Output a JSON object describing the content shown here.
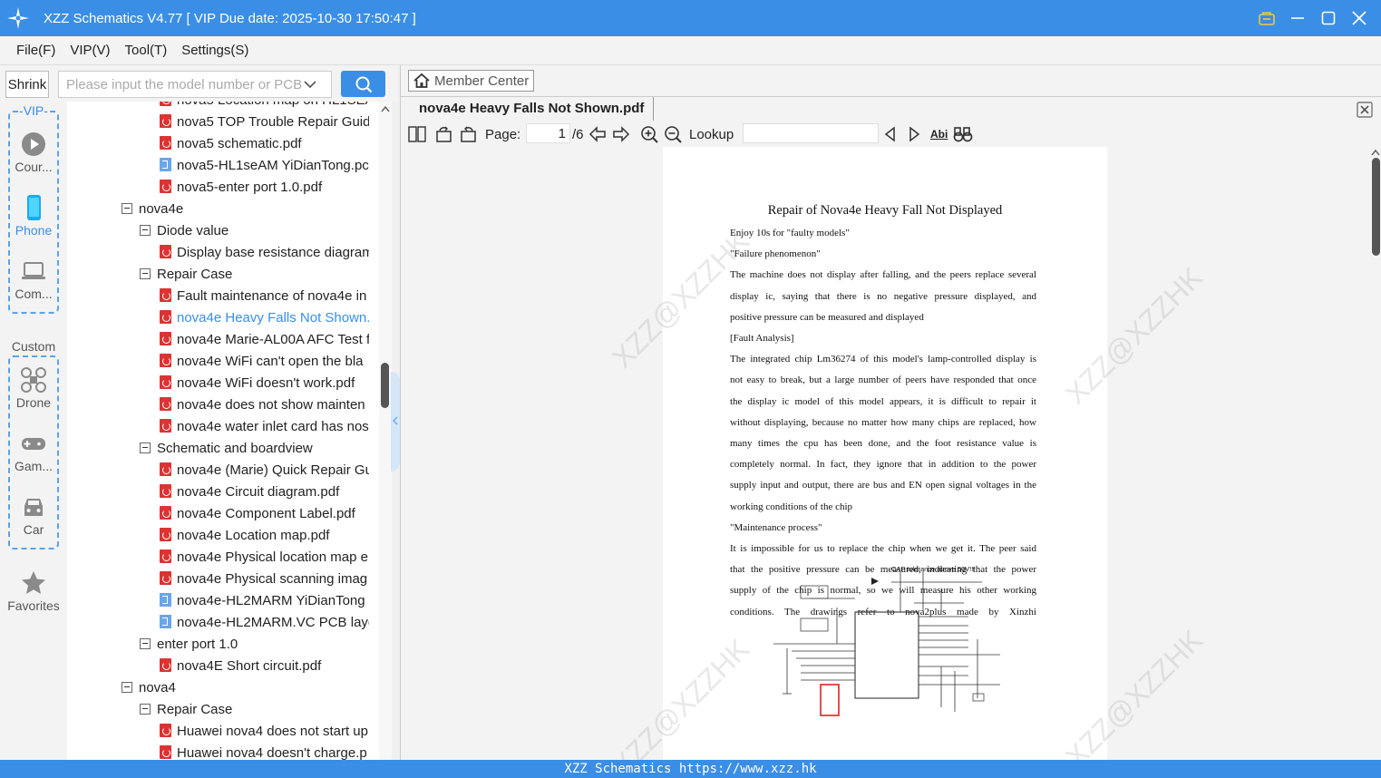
{
  "window": {
    "title": "XZZ Schematics V4.77 [ VIP Due date: 2025-10-30 17:50:47 ]"
  },
  "menu": [
    "File(F)",
    "VIP(V)",
    "Tool(T)",
    "Settings(S)"
  ],
  "search": {
    "shrink_label": "Shrink",
    "placeholder": "Please input the model number or PCB"
  },
  "leftnav": {
    "vip_label": "-VIP-",
    "custom_label": "Custom",
    "items": [
      "Cour...",
      "Phone",
      "Com...",
      "Drone",
      "Gam...",
      "Car"
    ],
    "favorites": "Favorites"
  },
  "tree": [
    {
      "type": "pdf",
      "level": 2,
      "label": "nova5 Location map on HL1SEA..."
    },
    {
      "type": "pdf",
      "level": 2,
      "label": "nova5 TOP Trouble Repair Guid"
    },
    {
      "type": "pdf",
      "level": 2,
      "label": "nova5 schematic.pdf"
    },
    {
      "type": "pcb",
      "level": 2,
      "label": "nova5-HL1seAM YiDianTong.pc"
    },
    {
      "type": "pdf",
      "level": 2,
      "label": "nova5-enter port 1.0.pdf"
    },
    {
      "type": "folder",
      "level": 0,
      "label": "nova4e"
    },
    {
      "type": "folder",
      "level": 1,
      "label": "Diode value"
    },
    {
      "type": "pdf",
      "level": 2,
      "label": "Display base resistance diagram"
    },
    {
      "type": "folder",
      "level": 1,
      "label": "Repair Case"
    },
    {
      "type": "pdf",
      "level": 2,
      "label": "Fault maintenance of nova4e in"
    },
    {
      "type": "pdf",
      "level": 2,
      "label": "nova4e Heavy Falls Not Shown.pdf",
      "active": true
    },
    {
      "type": "pdf",
      "level": 2,
      "label": "nova4e Marie-AL00A AFC Test f"
    },
    {
      "type": "pdf",
      "level": 2,
      "label": "nova4e WiFi can't open the bla"
    },
    {
      "type": "pdf",
      "level": 2,
      "label": "nova4e WiFi doesn't work.pdf"
    },
    {
      "type": "pdf",
      "level": 2,
      "label": "nova4e does not show mainten"
    },
    {
      "type": "pdf",
      "level": 2,
      "label": "nova4e water inlet card has nos"
    },
    {
      "type": "folder",
      "level": 1,
      "label": "Schematic and boardview"
    },
    {
      "type": "pdf",
      "level": 2,
      "label": "nova4e (Marie) Quick Repair Gu"
    },
    {
      "type": "pdf",
      "level": 2,
      "label": "nova4e Circuit diagram.pdf"
    },
    {
      "type": "pdf",
      "level": 2,
      "label": "nova4e Component Label.pdf"
    },
    {
      "type": "pdf",
      "level": 2,
      "label": "nova4e Location map.pdf"
    },
    {
      "type": "pdf",
      "level": 2,
      "label": "nova4e Physical location map e"
    },
    {
      "type": "pdf",
      "level": 2,
      "label": "nova4e Physical scanning imag"
    },
    {
      "type": "pcb",
      "level": 2,
      "label": "nova4e-HL2MARM YiDianTong"
    },
    {
      "type": "pcb",
      "level": 2,
      "label": "nova4e-HL2MARM.VC PCB laye"
    },
    {
      "type": "folder",
      "level": 1,
      "label": "enter port 1.0"
    },
    {
      "type": "pdf",
      "level": 2,
      "label": "nova4E Short circuit.pdf"
    },
    {
      "type": "folder",
      "level": 0,
      "label": "nova4"
    },
    {
      "type": "folder",
      "level": 1,
      "label": "Repair Case"
    },
    {
      "type": "pdf",
      "level": 2,
      "label": "Huawei nova4 does not start up"
    },
    {
      "type": "pdf",
      "level": 2,
      "label": "Huawei nova4 doesn't charge.p"
    }
  ],
  "viewer": {
    "member_center": "Member Center",
    "tab_title": "nova4e Heavy Falls Not Shown.pdf",
    "page_label": "Page:",
    "page_current": "1",
    "page_total": "/6",
    "lookup_label": "Lookup",
    "abi_label": "Abi"
  },
  "document": {
    "title": "Repair of Nova4e Heavy Fall Not Displayed",
    "lines": [
      "Enjoy 10s for \"faulty models\"",
      "\"Failure phenomenon\"",
      "The machine does not display after falling, and the peers replace several",
      "display ic, saying that there is no negative pressure displayed, and",
      "positive pressure can be measured and displayed",
      "[Fault Analysis]",
      "The integrated chip Lm36274 of this model's lamp-controlled display is",
      "not easy to break, but a large number of peers have responded that once",
      "the display ic model of this model appears, it is difficult to repair it",
      "without displaying, because no matter how many chips are replaced, how",
      "many times the cpu has been done, and the foot resistance value is",
      "completely normal. In fact, they ignore that in addition to the power",
      "supply input and output, there are bus and EN open signal voltages in the",
      "working conditions of the chip",
      "\"Maintenance process\"",
      "It is impossible for us to replace the chip when we get it. The peer said",
      "that the positive pressure can be measured, indicating that the power",
      "supply of the chip is normal, so we will measure his other working",
      "conditions. The drawings refer to nova2plus made by Xinzhi"
    ],
    "schematic_note": "CAP tolerance above 50V!!!",
    "watermark": "XZZ@XZZHK"
  },
  "statusbar": "XZZ Schematics https://www.xzz.hk"
}
